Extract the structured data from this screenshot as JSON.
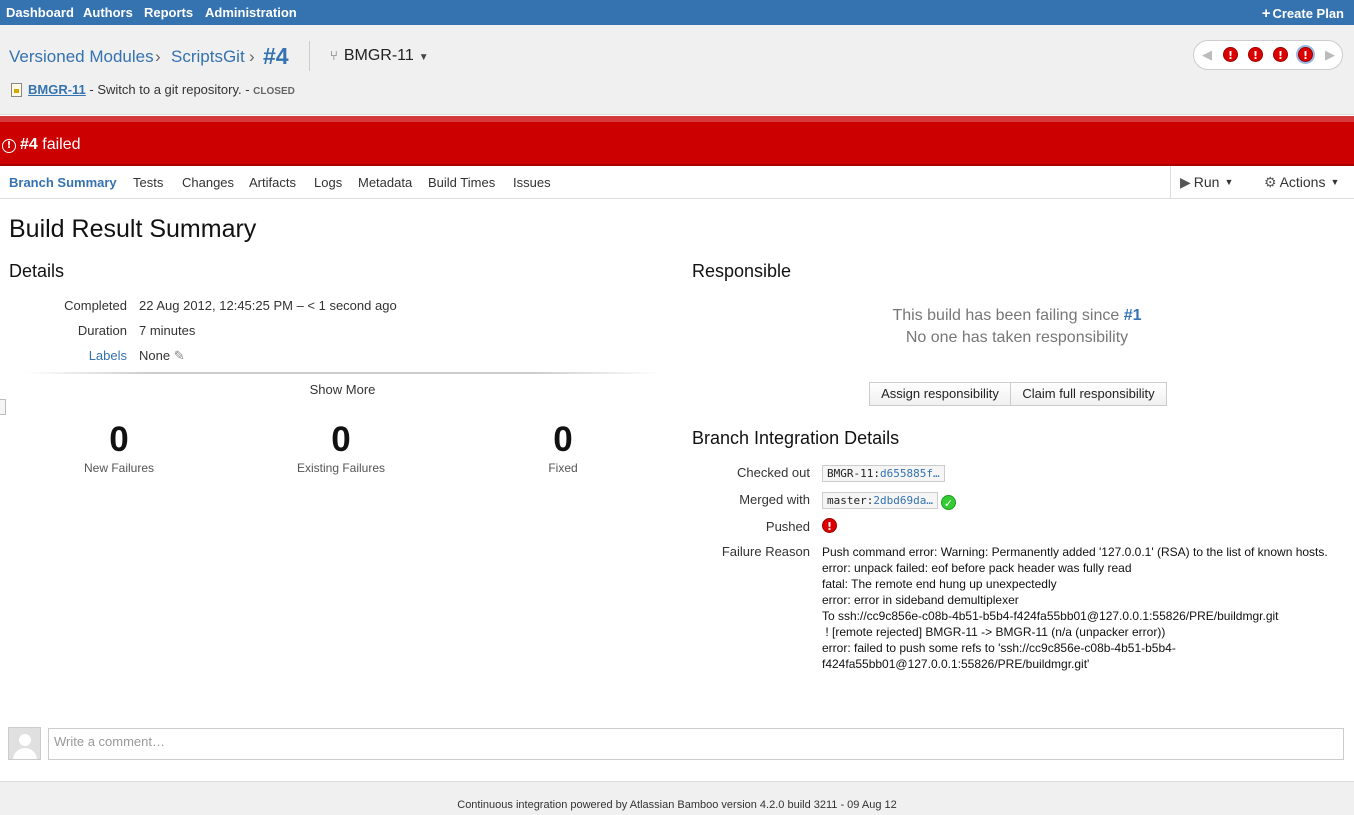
{
  "topnav": {
    "items": [
      "Dashboard",
      "Authors",
      "Reports",
      "Administration"
    ],
    "create_plan": "Create Plan"
  },
  "breadcrumb": {
    "project": "Versioned Modules",
    "plan": "ScriptsGit",
    "separator": "›",
    "build_number": "#4",
    "branch": "BMGR-11"
  },
  "issue": {
    "key": "BMGR-11",
    "summary": " - Switch to a git repository. - ",
    "status": "CLOSED"
  },
  "history": {
    "left_arrow": "◀",
    "right_arrow": "▶",
    "dots": [
      "!",
      "!",
      "!",
      "!"
    ]
  },
  "banner": {
    "icon": "!",
    "number": "#4",
    "text": " failed"
  },
  "tabs": [
    "Branch Summary",
    "Tests",
    "Changes",
    "Artifacts",
    "Logs",
    "Metadata",
    "Build Times",
    "Issues"
  ],
  "tools": {
    "run": "Run",
    "actions": "Actions"
  },
  "page": {
    "title": "Build Result Summary"
  },
  "details": {
    "heading": "Details",
    "completed_label": "Completed",
    "completed_value": "22 Aug 2012, 12:45:25 PM – < 1 second ago",
    "duration_label": "Duration",
    "duration_value": "7 minutes",
    "labels_label": "Labels",
    "labels_value": "None",
    "show_more": "Show More"
  },
  "stats": [
    {
      "value": "0",
      "label": "New Failures"
    },
    {
      "value": "0",
      "label": "Existing Failures"
    },
    {
      "value": "0",
      "label": "Fixed"
    }
  ],
  "responsible": {
    "heading": "Responsible",
    "line1_prefix": "This build has been failing since ",
    "line1_link": "#1",
    "line2": "No one has taken responsibility",
    "assign_button": "Assign responsibility",
    "claim_button": "Claim full responsibility"
  },
  "integration": {
    "heading": "Branch Integration Details",
    "checked_out_label": "Checked out",
    "checked_out_branch": "BMGR-11:",
    "checked_out_hash": "d655885f…",
    "merged_with_label": "Merged with",
    "merged_with_branch": "master:",
    "merged_with_hash": "2dbd69da…",
    "pushed_label": "Pushed",
    "failure_reason_label": "Failure Reason",
    "failure_reason_lines": [
      "Push command error: Warning: Permanently added '127.0.0.1' (RSA) to the list of known hosts.",
      "error: unpack failed: eof before pack header was fully read",
      "fatal: The remote end hung up unexpectedly",
      "error: error in sideband demultiplexer",
      "To ssh://cc9c856e-c08b-4b51-b5b4-f424fa55bb01@127.0.0.1:55826/PRE/buildmgr.git",
      " ! [remote rejected] BMGR-11 -> BMGR-11 (n/a (unpacker error))",
      "error: failed to push some refs to 'ssh://cc9c856e-c08b-4b51-b5b4-f424fa55bb01@127.0.0.1:55826/PRE/buildmgr.git'"
    ]
  },
  "comment": {
    "placeholder": "Write a comment…"
  },
  "footer": {
    "text": "Continuous integration powered by Atlassian Bamboo version 4.2.0 build 3211 - 09 Aug 12"
  },
  "colors": {
    "accent": "#3572b0",
    "failed": "#cc0000",
    "success": "#33cc33"
  }
}
